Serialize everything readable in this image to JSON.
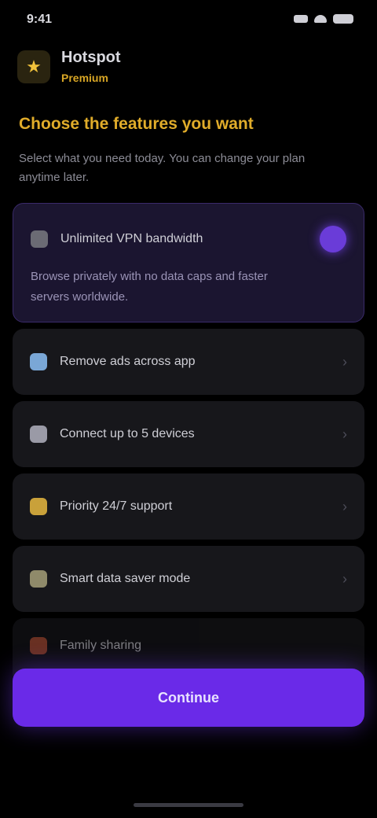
{
  "status_bar": {
    "time": "9:41"
  },
  "brand": {
    "app_name": "Hotspot",
    "tagline": "Premium",
    "logo_glyph": "★"
  },
  "headline": "Choose the features you want",
  "subtitle": "Select what you need today. You can change your plan anytime later.",
  "features": [
    {
      "title": "Unlimited VPN bandwidth",
      "desc": "Browse privately with no data caps and faster servers worldwide.",
      "icon_color": "#6b6b74",
      "active": true
    },
    {
      "title": "Remove ads across app",
      "icon_color": "#7aa7d6",
      "active": false
    },
    {
      "title": "Connect up to 5 devices",
      "icon_color": "#9a9aa6",
      "active": false
    },
    {
      "title": "Priority 24/7 support",
      "icon_color": "#c9a13a",
      "active": false
    },
    {
      "title": "Smart data saver mode",
      "icon_color": "#8f8a6a",
      "active": false
    },
    {
      "title": "Family sharing",
      "icon_color": "#b0503a",
      "active": false
    }
  ],
  "cta_label": "Continue",
  "colors": {
    "accent": "#6a2ae8",
    "gold": "#e0ac2a"
  }
}
